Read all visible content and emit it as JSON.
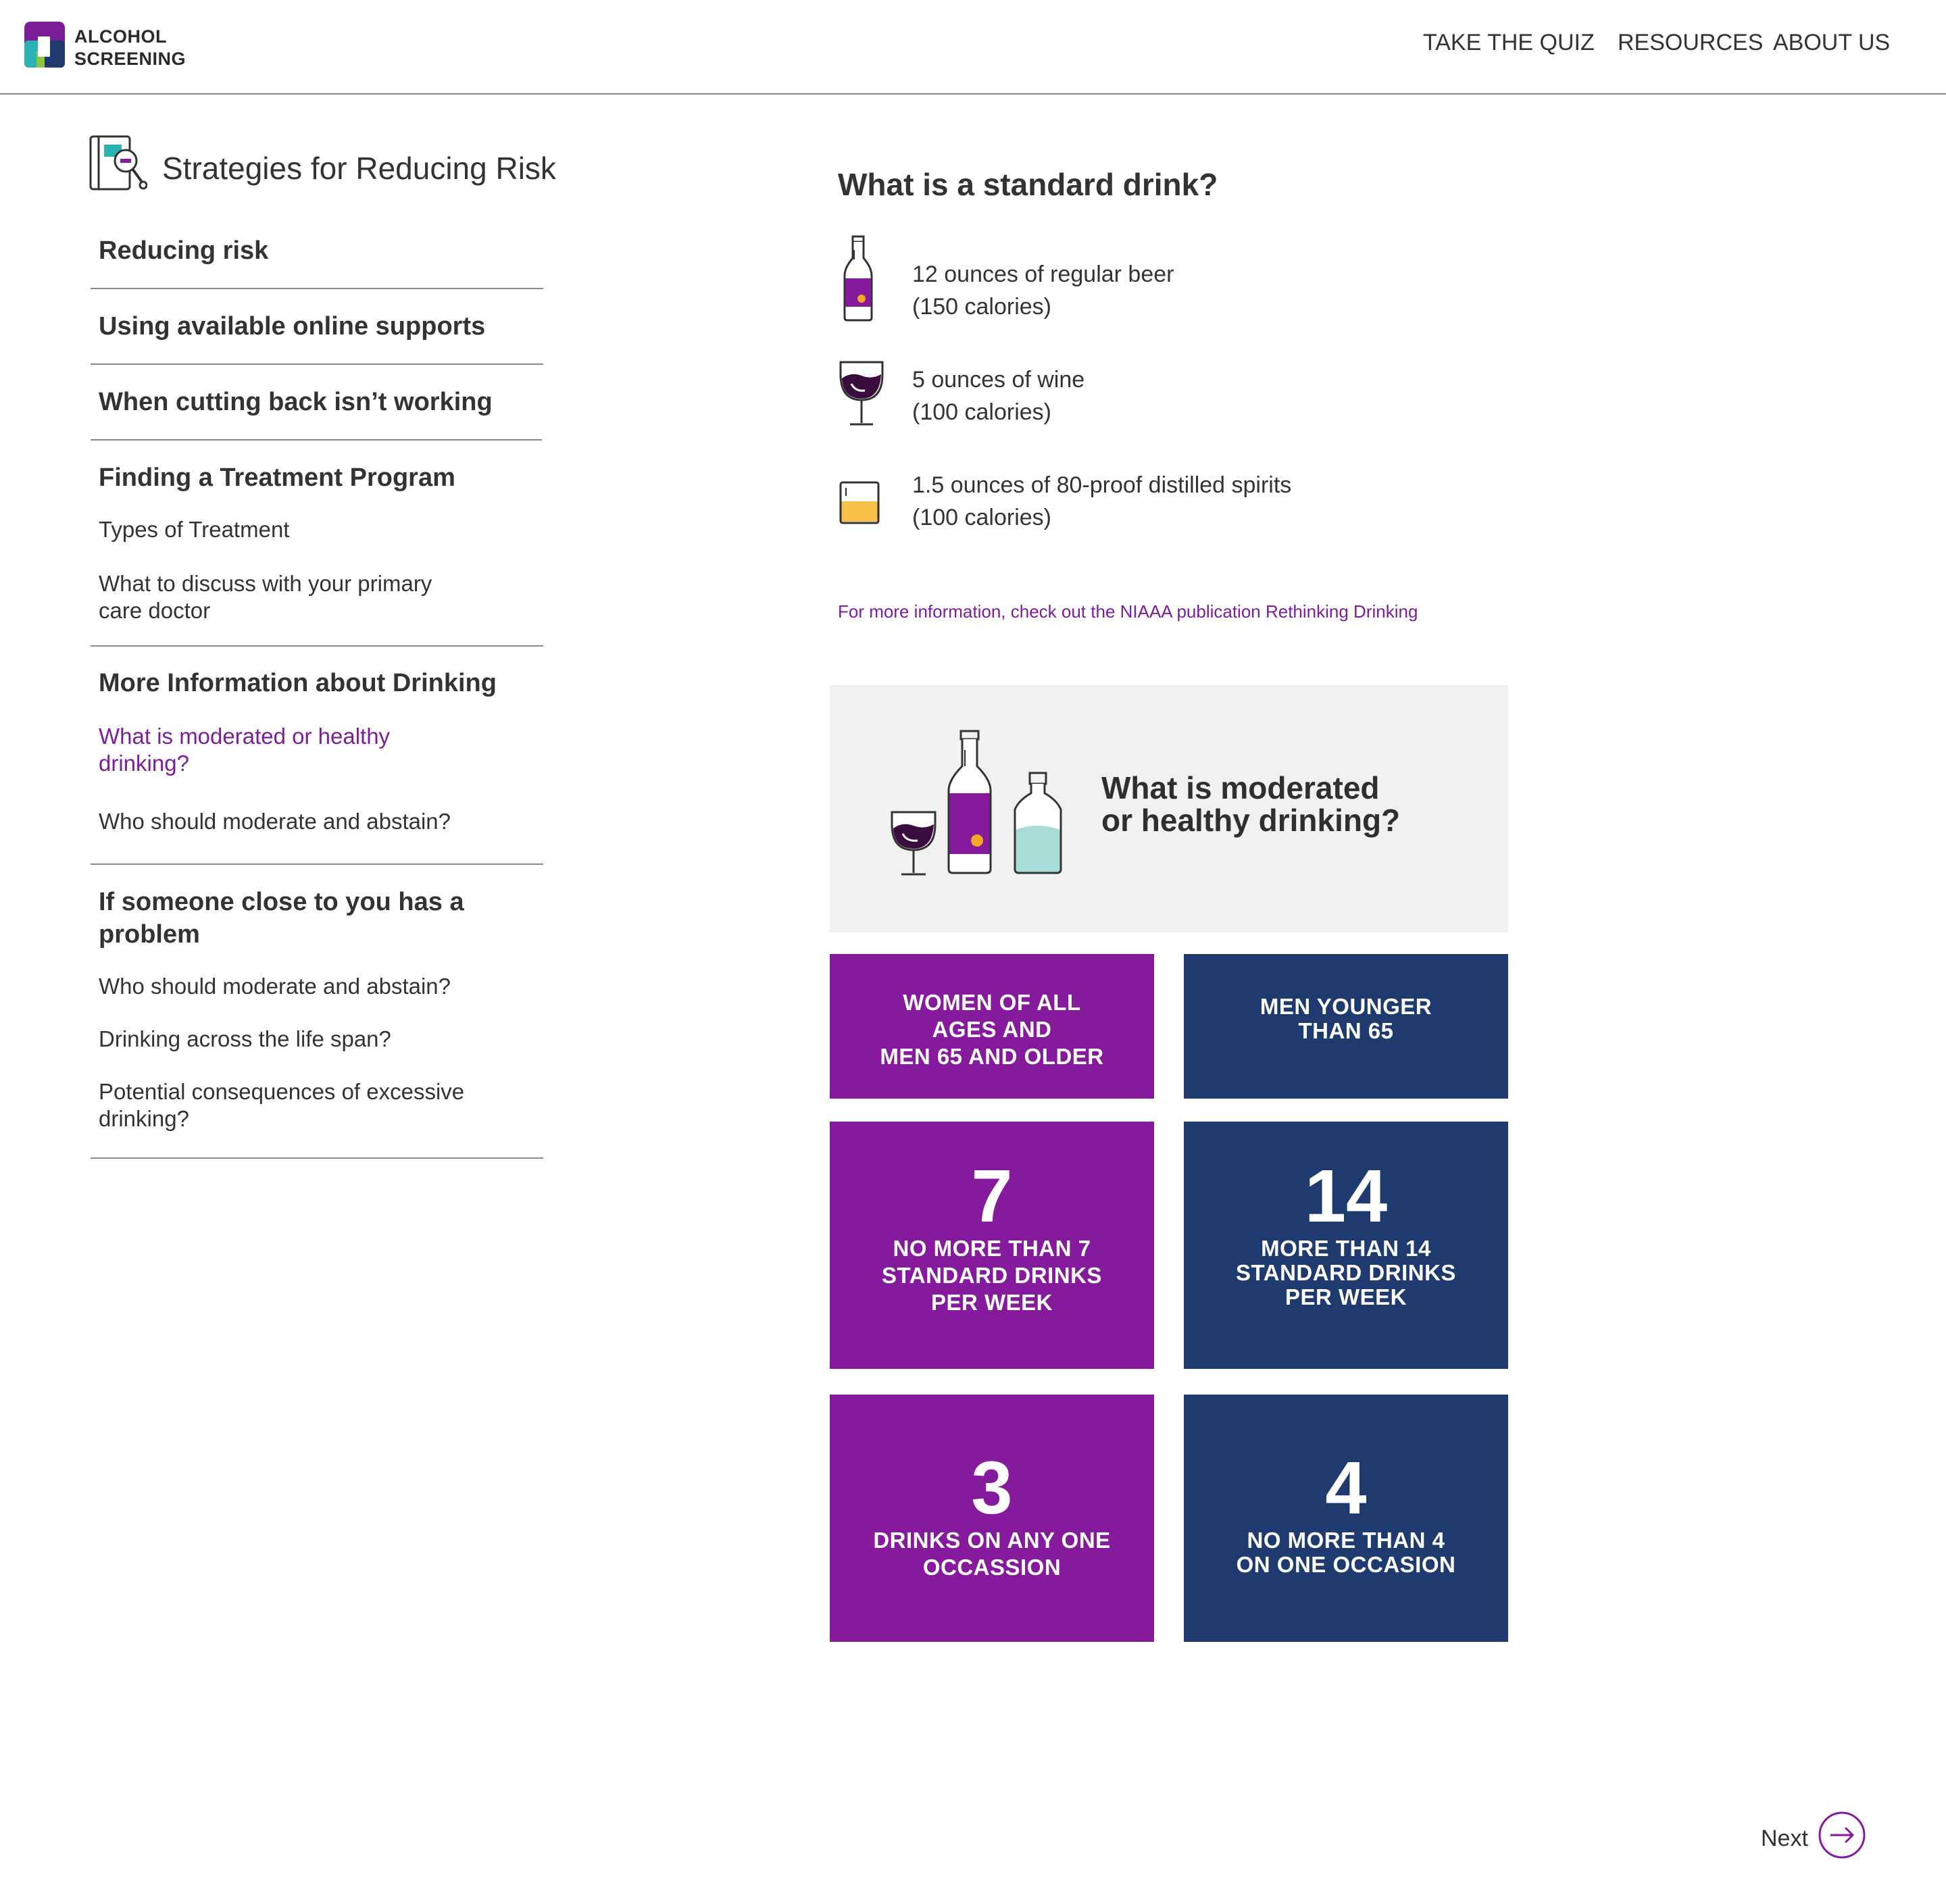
{
  "header": {
    "brand_line1": "ALCOHOL",
    "brand_line2": "SCREENING",
    "nav": [
      "TAKE THE QUIZ",
      "RESOURCES",
      "ABOUT US"
    ]
  },
  "sidebar": {
    "title": "Strategies for Reducing Risk",
    "sections": [
      {
        "heading": "Reducing risk"
      },
      {
        "heading": "Using available online supports"
      },
      {
        "heading": "When cutting back isn’t working"
      },
      {
        "heading": "Finding a Treatment Program",
        "links": [
          "Types of Treatment",
          "What to discuss with your primary",
          "care doctor"
        ]
      },
      {
        "heading": "More Information about Drinking",
        "links": [
          "What is moderated or healthy",
          "drinking?",
          "Who should moderate and abstain?"
        ]
      },
      {
        "heading_line1": "If someone close to you has a",
        "heading_line2": "problem",
        "links": [
          "Who should moderate and abstain?",
          "Drinking across the life span?",
          "Potential consequences of excessive",
          "drinking?"
        ]
      }
    ]
  },
  "main": {
    "title": "What is a standard drink?",
    "drinks": [
      {
        "icon": "beer-bottle-icon",
        "line1": "12 ounces of regular beer",
        "line2": "(150 calories)"
      },
      {
        "icon": "wine-glass-icon",
        "line1": "5 ounces of wine",
        "line2": "(100 calories)"
      },
      {
        "icon": "spirits-glass-icon",
        "line1": "1.5 ounces of 80-proof distilled spirits",
        "line2": "(100 calories)"
      }
    ],
    "more_info": "For more information, check out the NIAAA publication Rethinking Drinking",
    "promo_line1": "What is moderated",
    "promo_line2": "or healthy drinking?"
  },
  "tiles": {
    "women_header": [
      "WOMEN OF ALL",
      "AGES AND",
      "MEN 65 AND OLDER"
    ],
    "men_header": [
      "MEN YOUNGER",
      "THAN 65"
    ],
    "women_week_number": "7",
    "women_week_text": [
      "NO MORE THAN 7",
      "STANDARD DRINKS",
      "PER WEEK"
    ],
    "men_week_number": "14",
    "men_week_text": [
      "MORE THAN 14",
      "STANDARD DRINKS",
      "PER WEEK"
    ],
    "women_occasion_number": "3",
    "women_occasion_text": [
      "DRINKS ON ANY ONE",
      "OCCASSION"
    ],
    "men_occasion_number": "4",
    "men_occasion_text": [
      "NO MORE THAN 4",
      "ON ONE OCCASION"
    ]
  },
  "footer": {
    "next_label": "Next"
  },
  "colors": {
    "purple": "#861a9c",
    "navy": "#1f3a6e",
    "link_purple": "#7c1d9a",
    "promo_bg": "#f1f1f0"
  }
}
